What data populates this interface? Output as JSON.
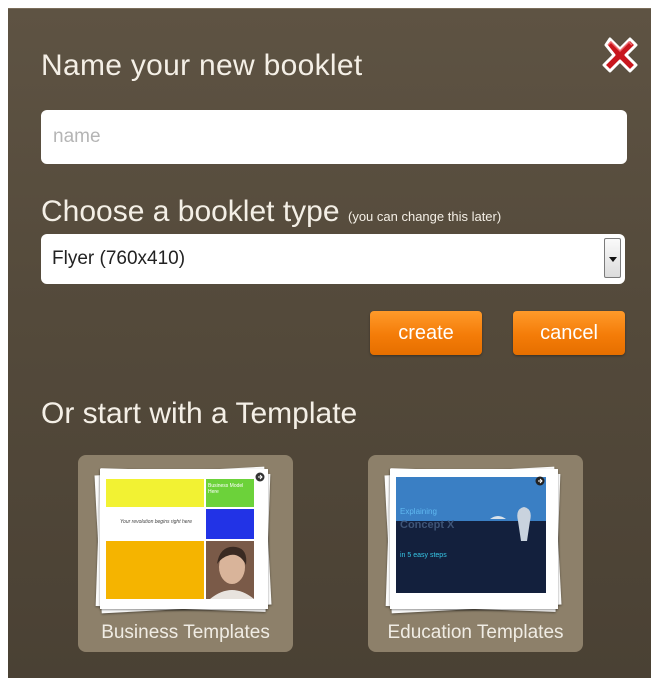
{
  "dialog": {
    "title": "Name your new booklet",
    "name_placeholder": "name",
    "name_value": "",
    "type_label": "Choose a booklet type",
    "type_hint": "(you can change this later)",
    "type_selected": "Flyer (760x410)",
    "create_label": "create",
    "cancel_label": "cancel",
    "templates_heading": "Or start with a Template",
    "close_icon": "close-x-icon",
    "accent_color": "#f47c08"
  },
  "templates": [
    {
      "label": "Business Templates",
      "thumb": {
        "tagline": "Your revolution begins right here",
        "corner_text": "Business Model Here"
      }
    },
    {
      "label": "Education Templates",
      "thumb": {
        "line1": "Explaining",
        "line2": "Concept X",
        "line3": "in 5 easy steps"
      }
    }
  ]
}
